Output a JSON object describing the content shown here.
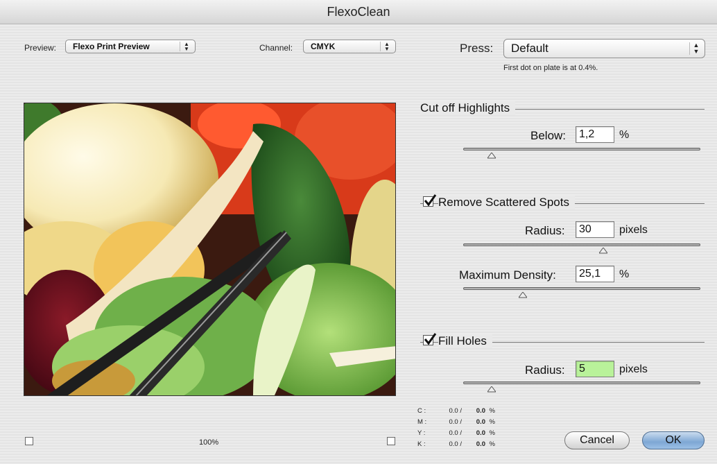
{
  "window": {
    "title": "FlexoClean"
  },
  "preview_select": {
    "label": "Preview:",
    "value": "Flexo Print Preview"
  },
  "channel_select": {
    "label": "Channel:",
    "value": "CMYK"
  },
  "press_select": {
    "label": "Press:",
    "value": "Default",
    "note": "First dot on plate is at 0.4%."
  },
  "highlights": {
    "heading": "Cut off Highlights",
    "below_label": "Below:",
    "below_value": "1,2",
    "unit": "%",
    "slider_fraction": 0.12
  },
  "scattered": {
    "heading": "Remove Scattered Spots",
    "checked": true,
    "radius_label": "Radius:",
    "radius_value": "30",
    "radius_unit": "pixels",
    "radius_slider_fraction": 0.59,
    "density_label": "Maximum Density:",
    "density_value": "25,1",
    "density_unit": "%",
    "density_slider_fraction": 0.25
  },
  "fill_holes": {
    "heading": "Fill Holes",
    "checked": true,
    "radius_label": "Radius:",
    "radius_value": "5",
    "radius_unit": "pixels",
    "slider_fraction": 0.12
  },
  "zoom": "100%",
  "readout": [
    {
      "channel": "C :",
      "value1": "0.0 /",
      "value2": "0.0",
      "unit": "%"
    },
    {
      "channel": "M :",
      "value1": "0.0 /",
      "value2": "0.0",
      "unit": "%"
    },
    {
      "channel": "Y :",
      "value1": "0.0 /",
      "value2": "0.0",
      "unit": "%"
    },
    {
      "channel": "K :",
      "value1": "0.0 /",
      "value2": "0.0",
      "unit": "%"
    }
  ],
  "buttons": {
    "cancel": "Cancel",
    "ok": "OK"
  },
  "colors": {
    "ok_accent": "#7ea7d4",
    "highlighted_field": "#b9f29a"
  },
  "icons": {
    "popup_arrows": "up-down-arrows-icon",
    "checkbox": "checkmark-icon"
  }
}
